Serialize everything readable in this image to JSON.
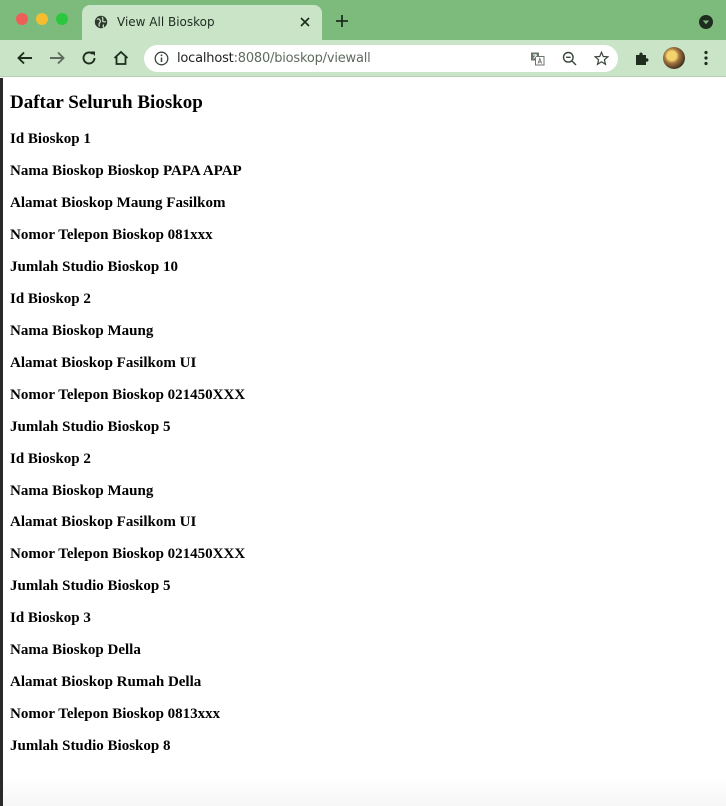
{
  "browser": {
    "tab_title": "View All Bioskop",
    "url_host": "localhost",
    "url_rest": ":8080/bioskop/viewall"
  },
  "page": {
    "title": "Daftar Seluruh Bioskop",
    "bioskop": [
      {
        "id": "Id Bioskop 1",
        "nama": "Nama Bioskop Bioskop PAPA APAP",
        "alamat": "Alamat Bioskop Maung Fasilkom",
        "telepon": "Nomor Telepon Bioskop 081xxx",
        "studio": "Jumlah Studio Bioskop 10"
      },
      {
        "id": "Id Bioskop 2",
        "nama": "Nama Bioskop Maung",
        "alamat": "Alamat Bioskop Fasilkom UI",
        "telepon": "Nomor Telepon Bioskop 021450XXX",
        "studio": "Jumlah Studio Bioskop 5"
      },
      {
        "id": "Id Bioskop 2",
        "nama": "Nama Bioskop Maung",
        "alamat": "Alamat Bioskop Fasilkom UI",
        "telepon": "Nomor Telepon Bioskop 021450XXX",
        "studio": "Jumlah Studio Bioskop 5"
      },
      {
        "id": "Id Bioskop 3",
        "nama": "Nama Bioskop Della",
        "alamat": "Alamat Bioskop Rumah Della",
        "telepon": "Nomor Telepon Bioskop 0813xxx",
        "studio": "Jumlah Studio Bioskop 8"
      }
    ]
  },
  "colors": {
    "tabstrip": "#7dbb7d",
    "toolbar": "#c9e4c7"
  }
}
